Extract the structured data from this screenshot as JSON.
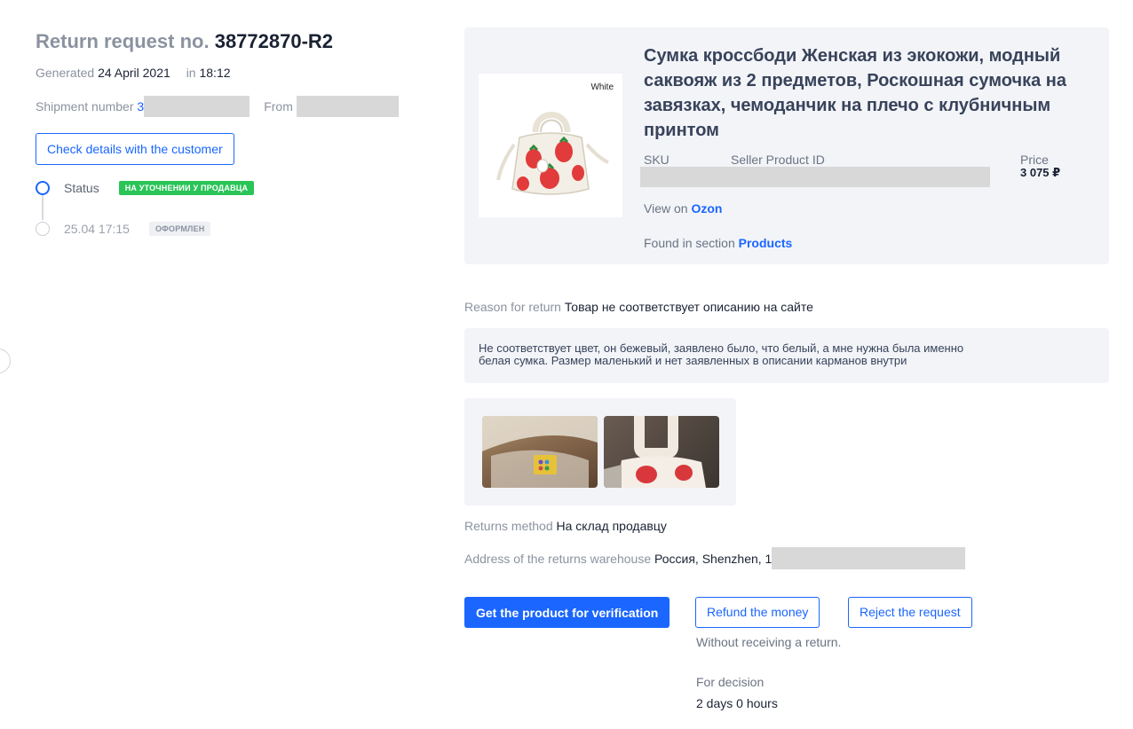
{
  "header": {
    "title_prefix": "Return request no.",
    "request_number": "38772870-R2",
    "generated_label": "Generated",
    "generated_date": "24 April 2021",
    "generated_in": "in",
    "generated_time": "18:12",
    "shipment_label": "Shipment number",
    "shipment_value_visible": "3",
    "from_label": "From",
    "check_button": "Check details with the customer"
  },
  "timeline": {
    "status_label": "Status",
    "status_badge": "НА УТОЧНЕНИИ У ПРОДАВЦА",
    "event_time": "25.04 17:15",
    "event_badge": "ОФОРМЛЕН",
    "colors": {
      "active": "#1a66ff",
      "status_badge": "#2ac457"
    }
  },
  "product": {
    "title": "Сумка кроссбоди Женская из экокожи, модный саквояж из 2 предметов, Роскошная сумочка на завязках, чемоданчик на плечо с клубничным принтом",
    "image_tag": "White",
    "sku_label": "SKU",
    "seller_id_label": "Seller Product ID",
    "price_label": "Price",
    "price_value": "3 075 ₽",
    "view_on_label": "View on",
    "view_on_link": "Ozon",
    "found_label": "Found in section",
    "found_link": "Products"
  },
  "return": {
    "reason_label": "Reason for return",
    "reason_value": "Товар не соответствует описанию на сайте",
    "comment_line1": "Не соответствует цвет, он бежевый, заявлено было, что белый, а мне нужна была именно",
    "comment_line2": "белая сумка. Размер маленький и нет заявленных в описании карманов внутри",
    "method_label": "Returns method",
    "method_value": "На склад продавцу",
    "address_label": "Address of the returns warehouse",
    "address_value": "Россия, Shenzhen, 1"
  },
  "actions": {
    "get_product": "Get the product for verification",
    "refund": "Refund the money",
    "reject": "Reject the request",
    "refund_note": "Without receiving a return.",
    "decision_label": "For decision",
    "decision_time": "2 days 0 hours"
  }
}
